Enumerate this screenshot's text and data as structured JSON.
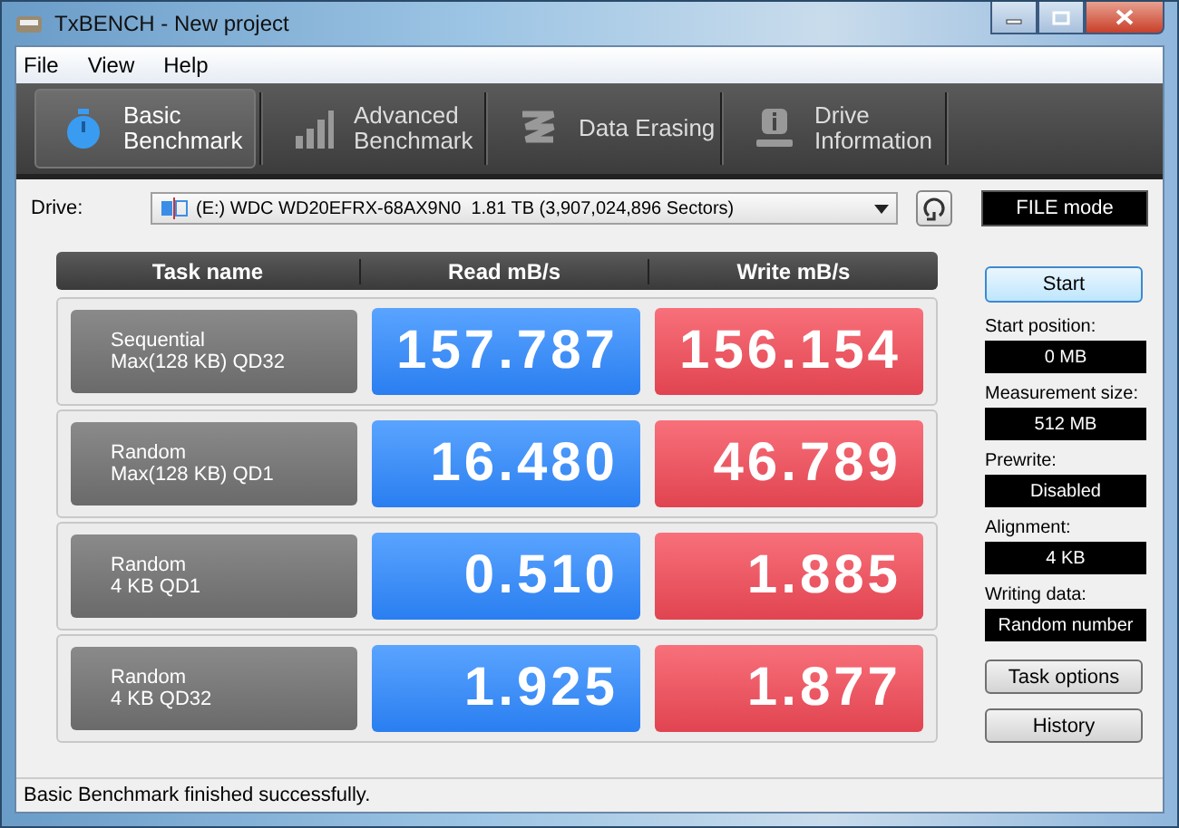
{
  "window": {
    "title": "TxBENCH - New project"
  },
  "menu": [
    {
      "label": "File"
    },
    {
      "label": "View"
    },
    {
      "label": "Help"
    }
  ],
  "tabs": [
    {
      "label": "Basic\nBenchmark",
      "kind": "stopwatch",
      "selected": true
    },
    {
      "label": "Advanced\nBenchmark",
      "kind": "bars",
      "selected": false
    },
    {
      "label": "Data Erasing",
      "kind": "zigzag",
      "selected": false
    },
    {
      "label": "Drive\nInformation",
      "kind": "info",
      "selected": false
    }
  ],
  "drive": {
    "label": "Drive:",
    "value": "(E:) WDC WD20EFRX-68AX9N0  1.81 TB (3,907,024,896 Sectors)",
    "mode": "FILE mode"
  },
  "table": {
    "columns": [
      "Task name",
      "Read mB/s",
      "Write mB/s"
    ],
    "rows": [
      {
        "task": "Sequential\nMax(128 KB) QD32",
        "read": "157.787",
        "write": "156.154"
      },
      {
        "task": "Random\nMax(128 KB) QD1",
        "read": "16.480",
        "write": "46.789"
      },
      {
        "task": "Random\n4 KB QD1",
        "read": "0.510",
        "write": "1.885"
      },
      {
        "task": "Random\n4 KB QD32",
        "read": "1.925",
        "write": "1.877"
      }
    ]
  },
  "start_button": "Start",
  "settings": [
    {
      "label": "Start position:",
      "value": "0 MB"
    },
    {
      "label": "Measurement size:",
      "value": "512 MB"
    },
    {
      "label": "Prewrite:",
      "value": "Disabled"
    },
    {
      "label": "Alignment:",
      "value": "4 KB"
    },
    {
      "label": "Writing data:",
      "value": "Random number"
    }
  ],
  "buttons": [
    {
      "label": "Task options"
    },
    {
      "label": "History"
    }
  ],
  "status_bar": "Basic Benchmark finished successfully."
}
